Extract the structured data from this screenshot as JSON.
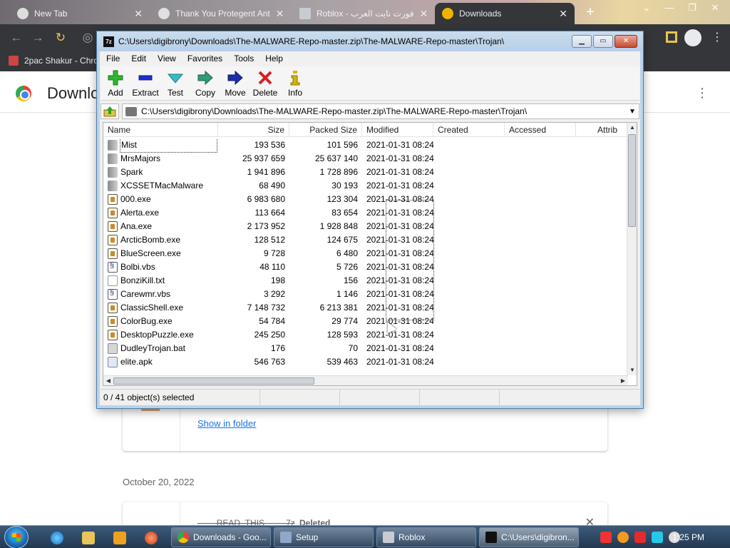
{
  "browser": {
    "tabs": [
      {
        "label": "New Tab",
        "favicon": "chrome-favicon-icon"
      },
      {
        "label": "Thank You Protegent Ant",
        "favicon": "protegent-favicon-icon"
      },
      {
        "label": "Roblox - فورت نايت العرب",
        "favicon": "roblox-favicon-icon"
      },
      {
        "label": "Downloads",
        "favicon": "download-favicon-icon"
      }
    ],
    "bookmark": "2pac Shakur - Chro",
    "page_title": "Downlo",
    "show_in_folder": "Show in folder",
    "date_heading": "October 20, 2022",
    "deleted_file": "____READ_THIS____.7z",
    "deleted_status": "Deleted"
  },
  "zip": {
    "title": "C:\\Users\\digibrony\\Downloads\\The-MALWARE-Repo-master.zip\\The-MALWARE-Repo-master\\Trojan\\",
    "menu": [
      "File",
      "Edit",
      "View",
      "Favorites",
      "Tools",
      "Help"
    ],
    "toolbar": [
      {
        "label": "Add",
        "icon": "add-plus-icon",
        "color": "#2fb52f"
      },
      {
        "label": "Extract",
        "icon": "extract-minus-icon",
        "color": "#1b2fd1"
      },
      {
        "label": "Test",
        "icon": "test-check-icon",
        "color": "#3ab8c8"
      },
      {
        "label": "Copy",
        "icon": "copy-arrow-icon",
        "color": "#2e9e7a"
      },
      {
        "label": "Move",
        "icon": "move-arrow-icon",
        "color": "#1b2fa8"
      },
      {
        "label": "Delete",
        "icon": "delete-x-icon",
        "color": "#d42020"
      },
      {
        "label": "Info",
        "icon": "info-i-icon",
        "color": "#d8b400"
      }
    ],
    "address": "C:\\Users\\digibrony\\Downloads\\The-MALWARE-Repo-master.zip\\The-MALWARE-Repo-master\\Trojan\\",
    "columns": [
      "Name",
      "Size",
      "Packed Size",
      "Modified",
      "Created",
      "Accessed",
      "Attrib"
    ],
    "rows": [
      {
        "name": "Mist",
        "type": "folder",
        "size": "193 536",
        "packed": "101 596",
        "modified": "2021-01-31 08:24"
      },
      {
        "name": "MrsMajors",
        "type": "folder",
        "size": "25 937 659",
        "packed": "25 637 140",
        "modified": "2021-01-31 08:24"
      },
      {
        "name": "Spark",
        "type": "folder",
        "size": "1 941 896",
        "packed": "1 728 896",
        "modified": "2021-01-31 08:24"
      },
      {
        "name": "XCSSETMacMalware",
        "type": "folder",
        "size": "68 490",
        "packed": "30 193",
        "modified": "2021-01-31 08:24"
      },
      {
        "name": "000.exe",
        "type": "exe",
        "size": "6 983 680",
        "packed": "123 304",
        "modified": "2021-01-31 08:24"
      },
      {
        "name": "Alerta.exe",
        "type": "exe",
        "size": "113 664",
        "packed": "83 654",
        "modified": "2021-01-31 08:24"
      },
      {
        "name": "Ana.exe",
        "type": "exe",
        "size": "2 173 952",
        "packed": "1 928 848",
        "modified": "2021-01-31 08:24"
      },
      {
        "name": "ArcticBomb.exe",
        "type": "exe",
        "size": "128 512",
        "packed": "124 675",
        "modified": "2021-01-31 08:24"
      },
      {
        "name": "BlueScreen.exe",
        "type": "exe",
        "size": "9 728",
        "packed": "6 480",
        "modified": "2021-01-31 08:24"
      },
      {
        "name": "Bolbi.vbs",
        "type": "vbs",
        "size": "48 110",
        "packed": "5 726",
        "modified": "2021-01-31 08:24"
      },
      {
        "name": "BonziKill.txt",
        "type": "txt",
        "size": "198",
        "packed": "156",
        "modified": "2021-01-31 08:24"
      },
      {
        "name": "Carewmr.vbs",
        "type": "vbs",
        "size": "3 292",
        "packed": "1 146",
        "modified": "2021-01-31 08:24"
      },
      {
        "name": "ClassicShell.exe",
        "type": "exe",
        "size": "7 148 732",
        "packed": "6 213 381",
        "modified": "2021-01-31 08:24"
      },
      {
        "name": "ColorBug.exe",
        "type": "exe",
        "size": "54 784",
        "packed": "29 774",
        "modified": "2021-01-31 08:24"
      },
      {
        "name": "DesktopPuzzle.exe",
        "type": "exe",
        "size": "245 250",
        "packed": "128 593",
        "modified": "2021-01-31 08:24"
      },
      {
        "name": "DudleyTrojan.bat",
        "type": "bat",
        "size": "176",
        "packed": "70",
        "modified": "2021-01-31 08:24"
      },
      {
        "name": "elite.apk",
        "type": "apk",
        "size": "546 763",
        "packed": "539 463",
        "modified": "2021-01-31 08:24"
      }
    ],
    "status": "0 / 41 object(s) selected"
  },
  "taskbar": {
    "tasks": [
      "Downloads - Goo...",
      "Setup",
      "Roblox",
      "C:\\Users\\digibron..."
    ],
    "clock": "1:25 PM"
  }
}
